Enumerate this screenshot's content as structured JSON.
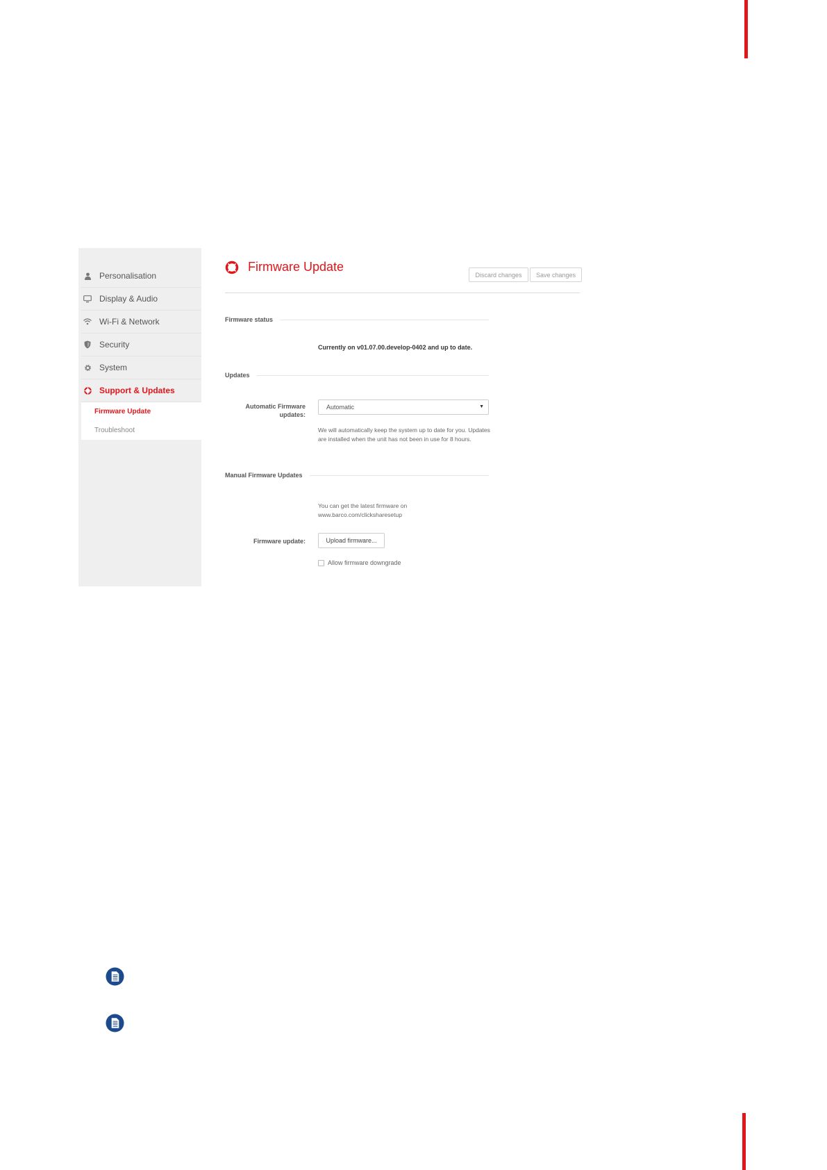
{
  "colors": {
    "accent": "#e0161b",
    "sidebar_bg": "#efefef",
    "note_blue": "#1c4a8c"
  },
  "sidebar": {
    "items": [
      {
        "label": "Personalisation",
        "icon": "person-icon"
      },
      {
        "label": "Display & Audio",
        "icon": "monitor-icon"
      },
      {
        "label": "Wi-Fi & Network",
        "icon": "wifi-icon"
      },
      {
        "label": "Security",
        "icon": "shield-icon"
      },
      {
        "label": "System",
        "icon": "gear-icon"
      },
      {
        "label": "Support & Updates",
        "icon": "lifebuoy-icon",
        "active": true
      }
    ],
    "subitems": [
      {
        "label": "Firmware Update",
        "active": true
      },
      {
        "label": "Troubleshoot"
      }
    ]
  },
  "header": {
    "title": "Firmware Update",
    "icon": "lifebuoy-icon",
    "discard_label": "Discard changes",
    "save_label": "Save changes"
  },
  "firmware_status": {
    "section_label": "Firmware status",
    "status_text": "Currently on v01.07.00.develop-0402 and up to date."
  },
  "updates": {
    "section_label": "Updates",
    "auto_label": "Automatic Firmware updates:",
    "auto_value": "Automatic",
    "help_text": "We will automatically keep the system up to date for you. Updates are installed when the unit has not been in use for 8 hours."
  },
  "manual": {
    "section_label": "Manual Firmware Updates",
    "help_text": "You can get the latest firmware on www.barco.com/clicksharesetup",
    "upload_label": "Firmware update:",
    "upload_button": "Upload firmware...",
    "downgrade_label": "Allow firmware downgrade",
    "downgrade_checked": false
  },
  "notes": [
    {
      "icon": "note-document-icon"
    },
    {
      "icon": "note-document-icon"
    }
  ]
}
